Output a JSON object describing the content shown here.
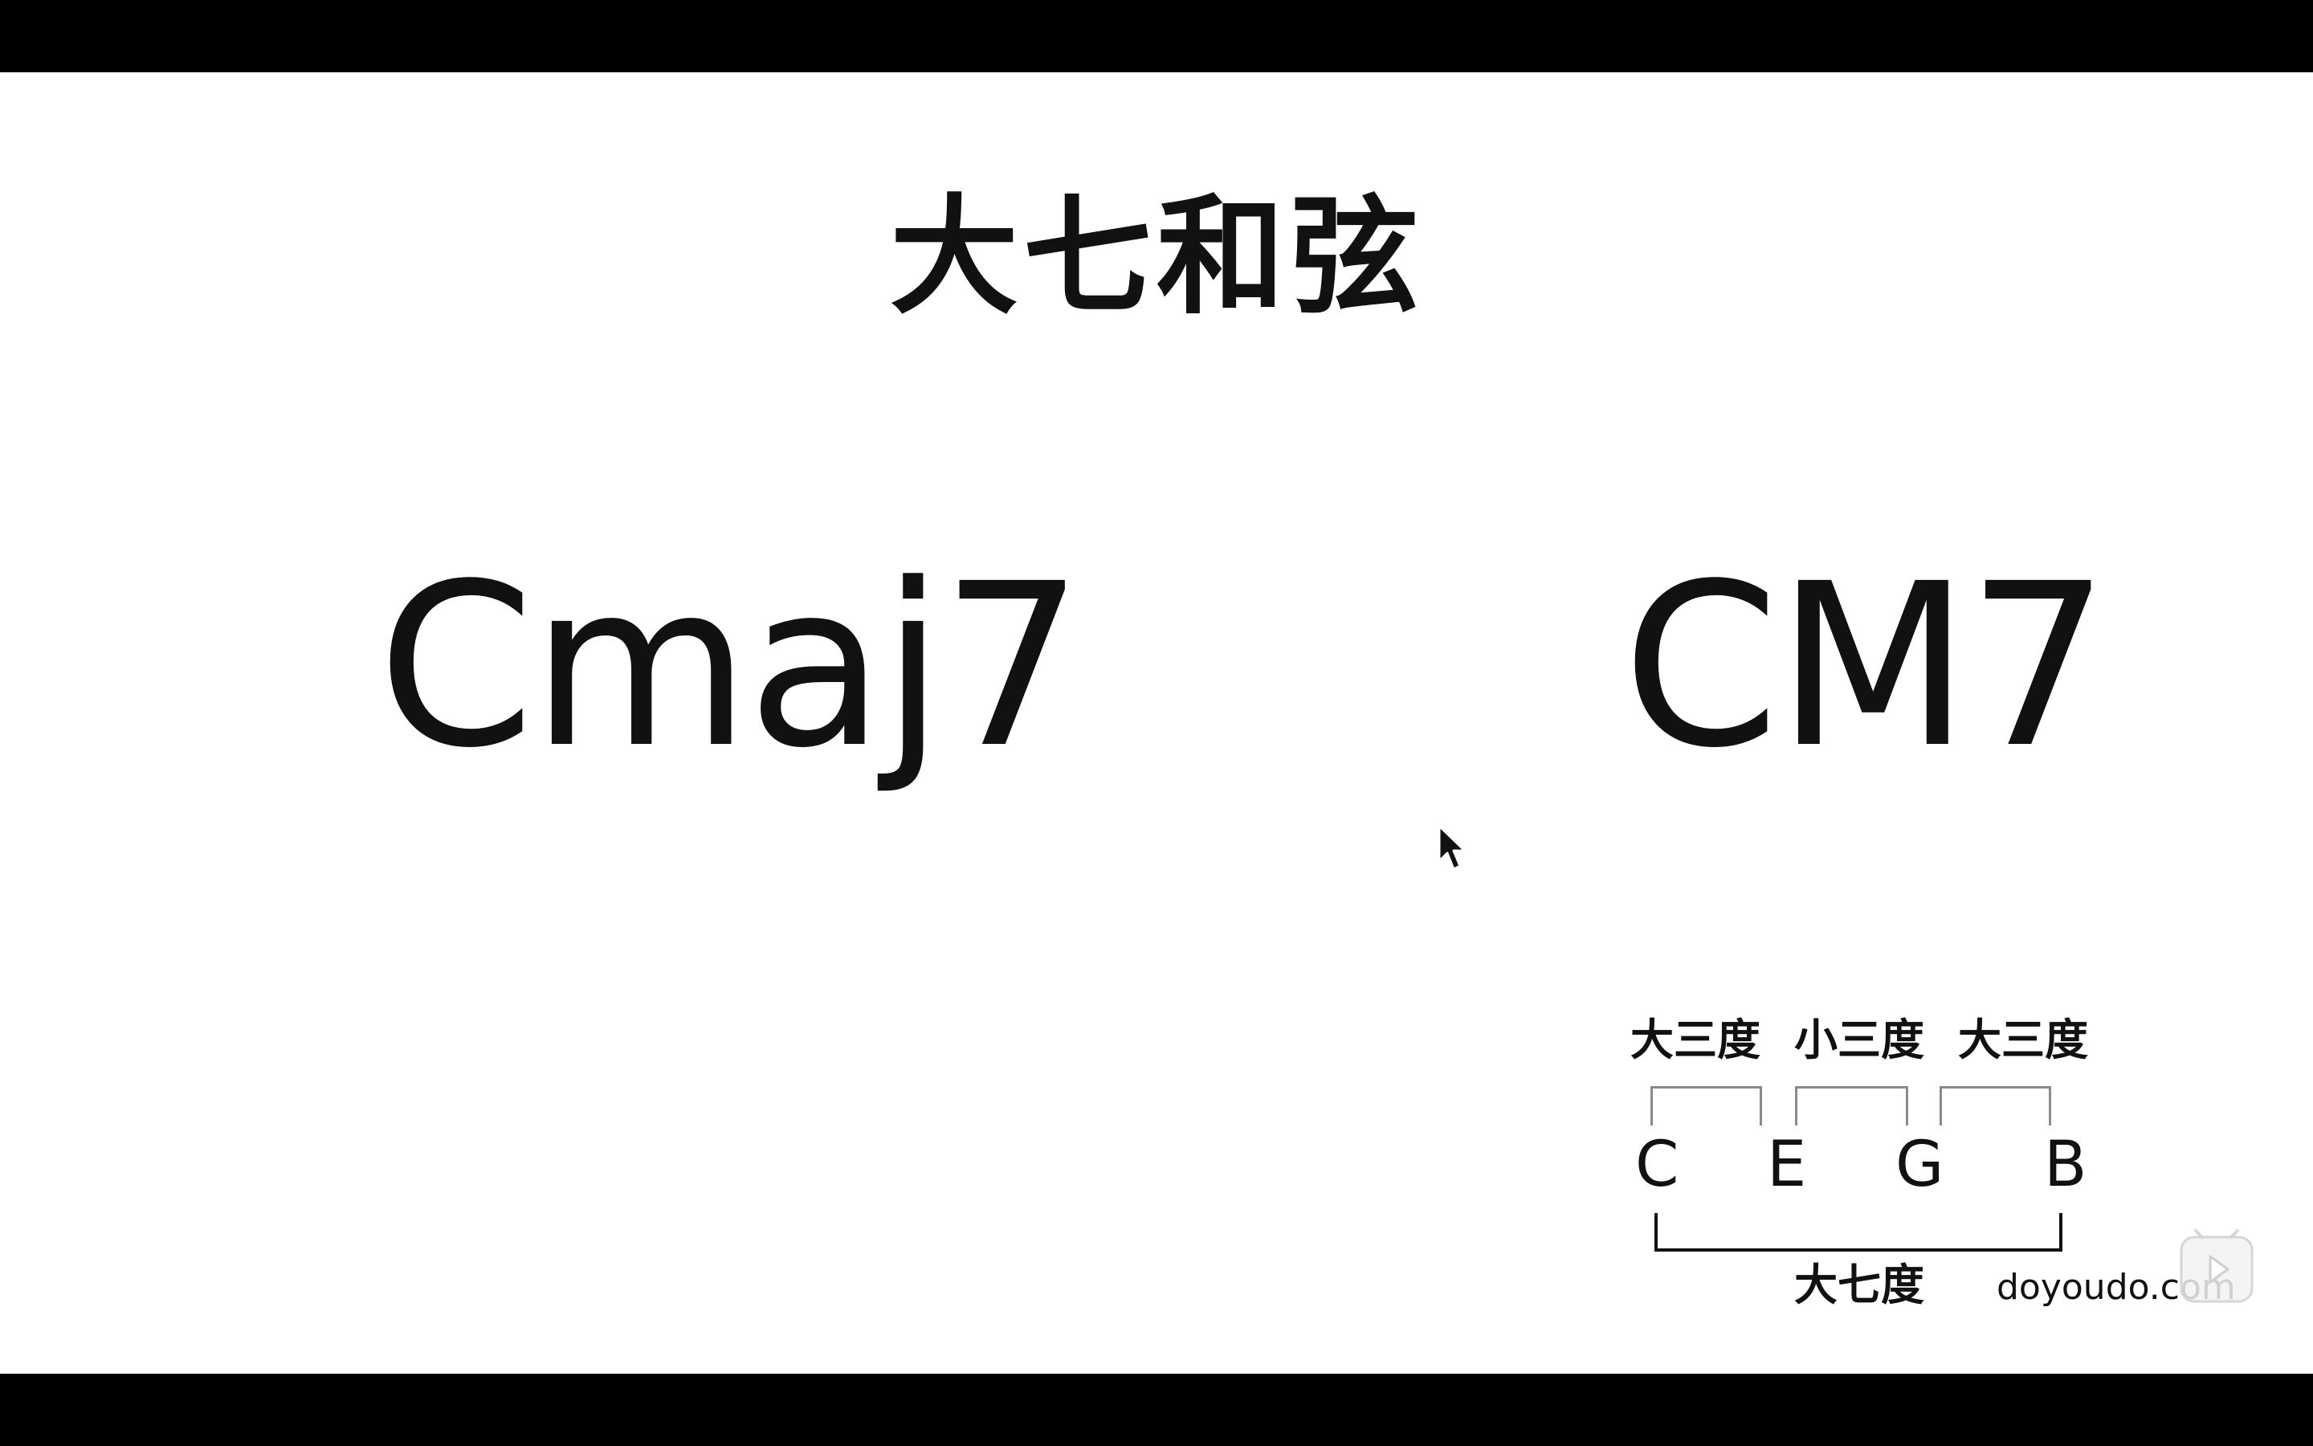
{
  "slide": {
    "title": "大七和弦",
    "chord_name_long": "Cmaj7",
    "chord_name_short": "CM7"
  },
  "diagram": {
    "intervals_top": [
      "大三度",
      "小三度",
      "大三度"
    ],
    "notes": [
      "C",
      "E",
      "G",
      "B"
    ],
    "interval_bottom": "大七度"
  },
  "watermark": {
    "text": "doyoudo.com"
  },
  "icons": {
    "cursor": "mouse-pointer-icon",
    "badge": "play-badge-icon"
  },
  "colors": {
    "background": "#ffffff",
    "letterbox": "#000000",
    "text": "#111111",
    "bracket_top": "#8a8a8a"
  }
}
